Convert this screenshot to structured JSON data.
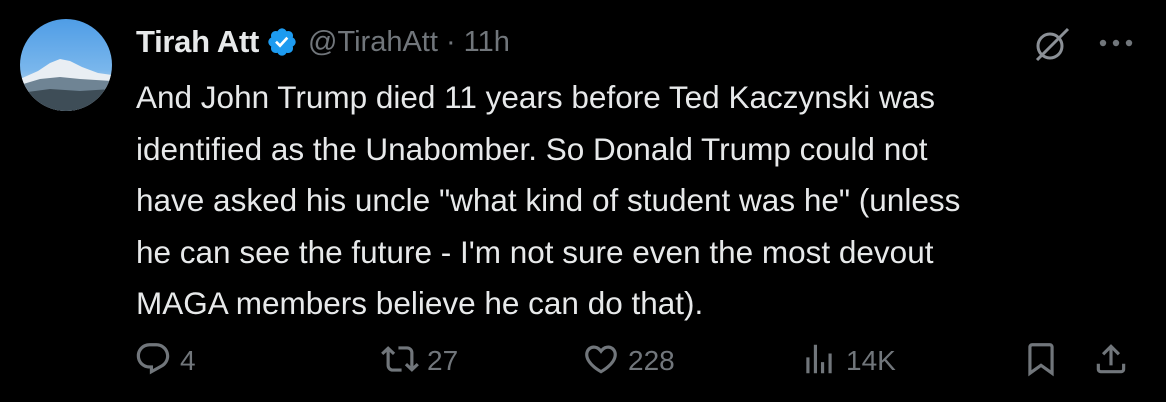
{
  "author": {
    "name": "Tirah Att",
    "handle": "@TirahAtt",
    "separator": "·",
    "time": "11h",
    "verified": true,
    "avatar_icon": "avatar-mountain-photo"
  },
  "tweet": {
    "text": "And John Trump died 11 years before Ted Kaczynski was\nidentified as the Unabomber. So Donald Trump could not\nhave asked his uncle \"what kind of student was he\" (unless\nhe can see the future - I'm not sure even the most devout\nMAGA members believe he can do that)."
  },
  "actions": {
    "reply": {
      "icon": "reply-icon",
      "count": "4"
    },
    "repost": {
      "icon": "repost-icon",
      "count": "27"
    },
    "like": {
      "icon": "heart-icon",
      "count": "228"
    },
    "views": {
      "icon": "views-icon",
      "count": "14K"
    },
    "bookmark": {
      "icon": "bookmark-icon"
    },
    "share": {
      "icon": "share-icon"
    }
  },
  "colors": {
    "background": "#000000",
    "text_primary": "#e7e9ea",
    "text_secondary": "#71767b",
    "verified_blue": "#1d9bf0"
  }
}
